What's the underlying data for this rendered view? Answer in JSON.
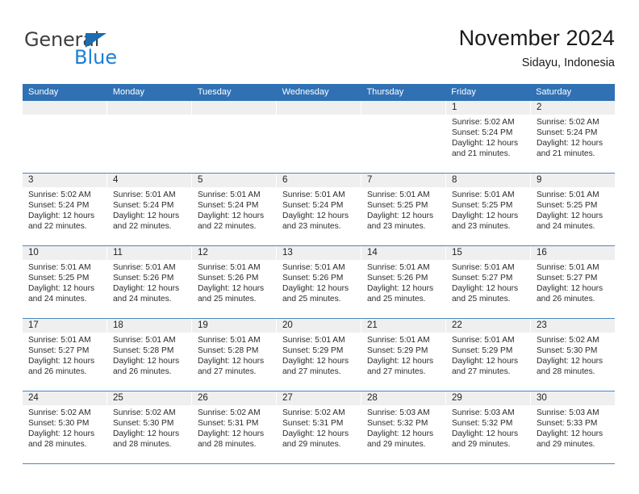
{
  "brand": {
    "name_part1": "General",
    "name_part2": "Blue",
    "triangle_color": "#1b6cb0",
    "blue_color": "#1b7fd4"
  },
  "header": {
    "title": "November 2024",
    "subtitle": "Sidayu, Indonesia"
  },
  "theme": {
    "header_bg": "#3071b4",
    "row_divider": "#4a87c0",
    "daynum_band": "#efefef",
    "text": "#222222"
  },
  "weekdays": [
    "Sunday",
    "Monday",
    "Tuesday",
    "Wednesday",
    "Thursday",
    "Friday",
    "Saturday"
  ],
  "weeks": [
    [
      {
        "day": "",
        "sunrise": "",
        "sunset": "",
        "daylight_1": "",
        "daylight_2": ""
      },
      {
        "day": "",
        "sunrise": "",
        "sunset": "",
        "daylight_1": "",
        "daylight_2": ""
      },
      {
        "day": "",
        "sunrise": "",
        "sunset": "",
        "daylight_1": "",
        "daylight_2": ""
      },
      {
        "day": "",
        "sunrise": "",
        "sunset": "",
        "daylight_1": "",
        "daylight_2": ""
      },
      {
        "day": "",
        "sunrise": "",
        "sunset": "",
        "daylight_1": "",
        "daylight_2": ""
      },
      {
        "day": "1",
        "sunrise": "Sunrise: 5:02 AM",
        "sunset": "Sunset: 5:24 PM",
        "daylight_1": "Daylight: 12 hours",
        "daylight_2": "and 21 minutes."
      },
      {
        "day": "2",
        "sunrise": "Sunrise: 5:02 AM",
        "sunset": "Sunset: 5:24 PM",
        "daylight_1": "Daylight: 12 hours",
        "daylight_2": "and 21 minutes."
      }
    ],
    [
      {
        "day": "3",
        "sunrise": "Sunrise: 5:02 AM",
        "sunset": "Sunset: 5:24 PM",
        "daylight_1": "Daylight: 12 hours",
        "daylight_2": "and 22 minutes."
      },
      {
        "day": "4",
        "sunrise": "Sunrise: 5:01 AM",
        "sunset": "Sunset: 5:24 PM",
        "daylight_1": "Daylight: 12 hours",
        "daylight_2": "and 22 minutes."
      },
      {
        "day": "5",
        "sunrise": "Sunrise: 5:01 AM",
        "sunset": "Sunset: 5:24 PM",
        "daylight_1": "Daylight: 12 hours",
        "daylight_2": "and 22 minutes."
      },
      {
        "day": "6",
        "sunrise": "Sunrise: 5:01 AM",
        "sunset": "Sunset: 5:24 PM",
        "daylight_1": "Daylight: 12 hours",
        "daylight_2": "and 23 minutes."
      },
      {
        "day": "7",
        "sunrise": "Sunrise: 5:01 AM",
        "sunset": "Sunset: 5:25 PM",
        "daylight_1": "Daylight: 12 hours",
        "daylight_2": "and 23 minutes."
      },
      {
        "day": "8",
        "sunrise": "Sunrise: 5:01 AM",
        "sunset": "Sunset: 5:25 PM",
        "daylight_1": "Daylight: 12 hours",
        "daylight_2": "and 23 minutes."
      },
      {
        "day": "9",
        "sunrise": "Sunrise: 5:01 AM",
        "sunset": "Sunset: 5:25 PM",
        "daylight_1": "Daylight: 12 hours",
        "daylight_2": "and 24 minutes."
      }
    ],
    [
      {
        "day": "10",
        "sunrise": "Sunrise: 5:01 AM",
        "sunset": "Sunset: 5:25 PM",
        "daylight_1": "Daylight: 12 hours",
        "daylight_2": "and 24 minutes."
      },
      {
        "day": "11",
        "sunrise": "Sunrise: 5:01 AM",
        "sunset": "Sunset: 5:26 PM",
        "daylight_1": "Daylight: 12 hours",
        "daylight_2": "and 24 minutes."
      },
      {
        "day": "12",
        "sunrise": "Sunrise: 5:01 AM",
        "sunset": "Sunset: 5:26 PM",
        "daylight_1": "Daylight: 12 hours",
        "daylight_2": "and 25 minutes."
      },
      {
        "day": "13",
        "sunrise": "Sunrise: 5:01 AM",
        "sunset": "Sunset: 5:26 PM",
        "daylight_1": "Daylight: 12 hours",
        "daylight_2": "and 25 minutes."
      },
      {
        "day": "14",
        "sunrise": "Sunrise: 5:01 AM",
        "sunset": "Sunset: 5:26 PM",
        "daylight_1": "Daylight: 12 hours",
        "daylight_2": "and 25 minutes."
      },
      {
        "day": "15",
        "sunrise": "Sunrise: 5:01 AM",
        "sunset": "Sunset: 5:27 PM",
        "daylight_1": "Daylight: 12 hours",
        "daylight_2": "and 25 minutes."
      },
      {
        "day": "16",
        "sunrise": "Sunrise: 5:01 AM",
        "sunset": "Sunset: 5:27 PM",
        "daylight_1": "Daylight: 12 hours",
        "daylight_2": "and 26 minutes."
      }
    ],
    [
      {
        "day": "17",
        "sunrise": "Sunrise: 5:01 AM",
        "sunset": "Sunset: 5:27 PM",
        "daylight_1": "Daylight: 12 hours",
        "daylight_2": "and 26 minutes."
      },
      {
        "day": "18",
        "sunrise": "Sunrise: 5:01 AM",
        "sunset": "Sunset: 5:28 PM",
        "daylight_1": "Daylight: 12 hours",
        "daylight_2": "and 26 minutes."
      },
      {
        "day": "19",
        "sunrise": "Sunrise: 5:01 AM",
        "sunset": "Sunset: 5:28 PM",
        "daylight_1": "Daylight: 12 hours",
        "daylight_2": "and 27 minutes."
      },
      {
        "day": "20",
        "sunrise": "Sunrise: 5:01 AM",
        "sunset": "Sunset: 5:29 PM",
        "daylight_1": "Daylight: 12 hours",
        "daylight_2": "and 27 minutes."
      },
      {
        "day": "21",
        "sunrise": "Sunrise: 5:01 AM",
        "sunset": "Sunset: 5:29 PM",
        "daylight_1": "Daylight: 12 hours",
        "daylight_2": "and 27 minutes."
      },
      {
        "day": "22",
        "sunrise": "Sunrise: 5:01 AM",
        "sunset": "Sunset: 5:29 PM",
        "daylight_1": "Daylight: 12 hours",
        "daylight_2": "and 27 minutes."
      },
      {
        "day": "23",
        "sunrise": "Sunrise: 5:02 AM",
        "sunset": "Sunset: 5:30 PM",
        "daylight_1": "Daylight: 12 hours",
        "daylight_2": "and 28 minutes."
      }
    ],
    [
      {
        "day": "24",
        "sunrise": "Sunrise: 5:02 AM",
        "sunset": "Sunset: 5:30 PM",
        "daylight_1": "Daylight: 12 hours",
        "daylight_2": "and 28 minutes."
      },
      {
        "day": "25",
        "sunrise": "Sunrise: 5:02 AM",
        "sunset": "Sunset: 5:30 PM",
        "daylight_1": "Daylight: 12 hours",
        "daylight_2": "and 28 minutes."
      },
      {
        "day": "26",
        "sunrise": "Sunrise: 5:02 AM",
        "sunset": "Sunset: 5:31 PM",
        "daylight_1": "Daylight: 12 hours",
        "daylight_2": "and 28 minutes."
      },
      {
        "day": "27",
        "sunrise": "Sunrise: 5:02 AM",
        "sunset": "Sunset: 5:31 PM",
        "daylight_1": "Daylight: 12 hours",
        "daylight_2": "and 29 minutes."
      },
      {
        "day": "28",
        "sunrise": "Sunrise: 5:03 AM",
        "sunset": "Sunset: 5:32 PM",
        "daylight_1": "Daylight: 12 hours",
        "daylight_2": "and 29 minutes."
      },
      {
        "day": "29",
        "sunrise": "Sunrise: 5:03 AM",
        "sunset": "Sunset: 5:32 PM",
        "daylight_1": "Daylight: 12 hours",
        "daylight_2": "and 29 minutes."
      },
      {
        "day": "30",
        "sunrise": "Sunrise: 5:03 AM",
        "sunset": "Sunset: 5:33 PM",
        "daylight_1": "Daylight: 12 hours",
        "daylight_2": "and 29 minutes."
      }
    ]
  ]
}
